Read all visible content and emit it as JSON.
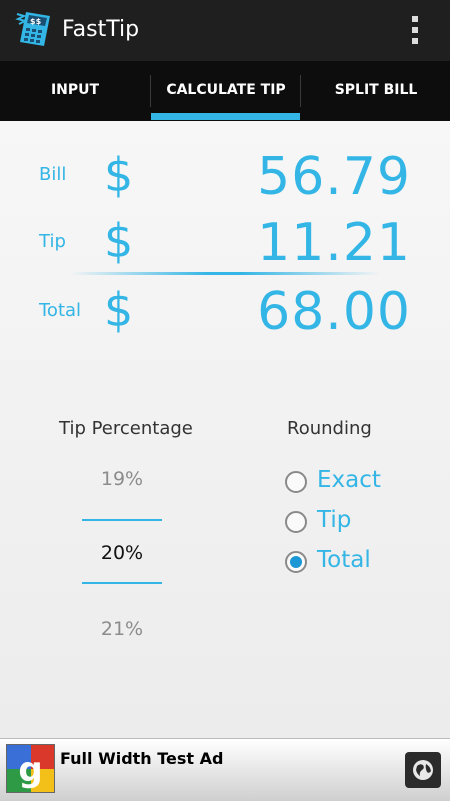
{
  "app": {
    "title": "FastTip"
  },
  "tabs": [
    {
      "label": "INPUT"
    },
    {
      "label": "CALCULATE TIP",
      "selected": true
    },
    {
      "label": "SPLIT BILL"
    }
  ],
  "summary": {
    "currency_symbol": "$",
    "bill": {
      "label": "Bill",
      "value": "56.79"
    },
    "tip": {
      "label": "Tip",
      "value": "11.21"
    },
    "total": {
      "label": "Total",
      "value": "68.00"
    }
  },
  "tip_percentage": {
    "title": "Tip Percentage",
    "previous": "19%",
    "selected": "20%",
    "next": "21%"
  },
  "rounding": {
    "title": "Rounding",
    "options": [
      {
        "label": "Exact",
        "checked": false
      },
      {
        "label": "Tip",
        "checked": false
      },
      {
        "label": "Total",
        "checked": true
      }
    ]
  },
  "ad": {
    "text": "Full Width Test Ad"
  },
  "colors": {
    "accent": "#33b5e5",
    "actionbar": "#1f1f1f",
    "tabbar": "#0d0d0d"
  },
  "icons": {
    "app": "calculator-icon",
    "menu": "overflow-menu-icon",
    "ad_logo": "google-logo-icon",
    "ad_action": "globe-icon"
  }
}
